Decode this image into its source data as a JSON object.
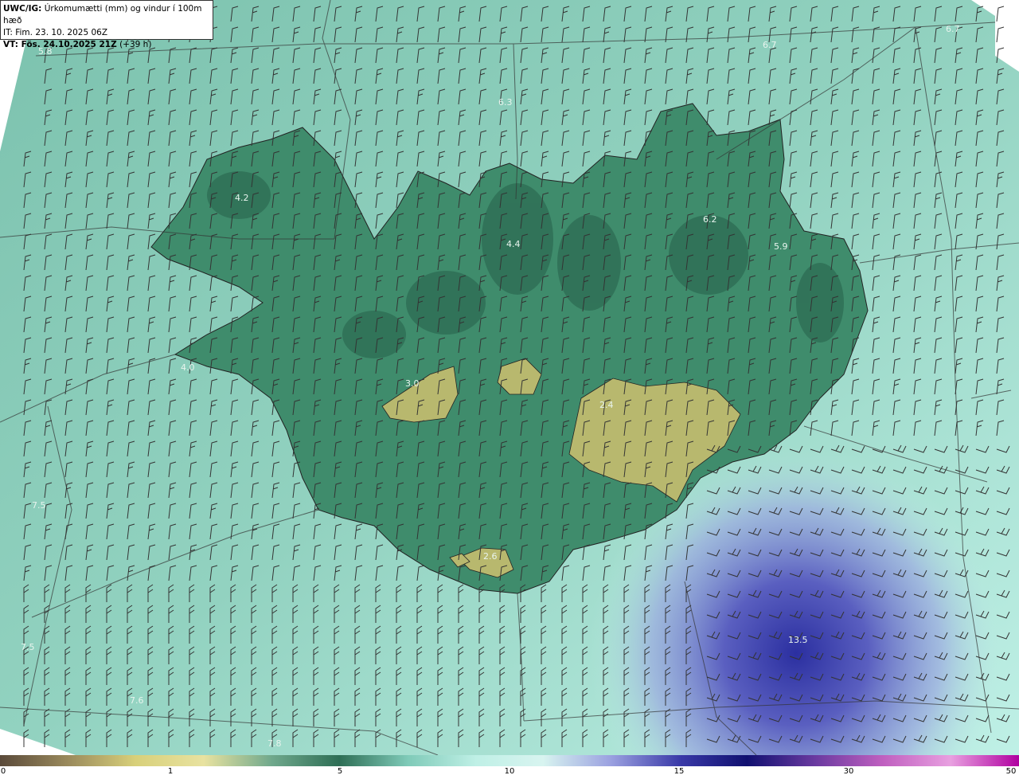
{
  "header": {
    "source": "UWC/IG:",
    "title": "Úrkomumætti (mm) og vindur í 100m hæð",
    "init_time": "IT: Fim. 23. 10. 2025 06Z",
    "valid_label": "VT: Fös. 24.10.2025 21Z",
    "valid_offset": "(+39 h)"
  },
  "colors": {
    "ocean_light": "#bfeee2",
    "ocean_mid": "#8fd0c0",
    "land_green": "#3f8c6c",
    "land_dark": "#2e6e55",
    "glacier": "#b8b86e",
    "blue_precip": "#6a6fc6",
    "deep_blue": "#2b2fa0",
    "barb": "#333333"
  },
  "value_labels": [
    {
      "text": "5.8"
    },
    {
      "text": "6.3"
    },
    {
      "text": "6.7"
    },
    {
      "text": "6.7"
    },
    {
      "text": "4.2"
    },
    {
      "text": "6.2"
    },
    {
      "text": "5.9"
    },
    {
      "text": "4.4"
    },
    {
      "text": "4.0"
    },
    {
      "text": "3.0"
    },
    {
      "text": "2.4"
    },
    {
      "text": "2.6"
    },
    {
      "text": "7.5"
    },
    {
      "text": "7.5"
    },
    {
      "text": "7.6"
    },
    {
      "text": "7.8"
    },
    {
      "text": "13.5"
    }
  ],
  "colorbar": {
    "ticks": [
      "0",
      "1",
      "5",
      "10",
      "15",
      "30",
      "50"
    ],
    "stops": [
      "#5a4a3a",
      "#9a8a5c",
      "#d8d07a",
      "#e8e2a0",
      "#6fa88c",
      "#2e6e55",
      "#7fcab8",
      "#bff0e6",
      "#d8f4f0",
      "#9aa0e0",
      "#3a3aa8",
      "#101070",
      "#6a3aa0",
      "#c060c0",
      "#e8a0e0",
      "#b000a0"
    ]
  }
}
